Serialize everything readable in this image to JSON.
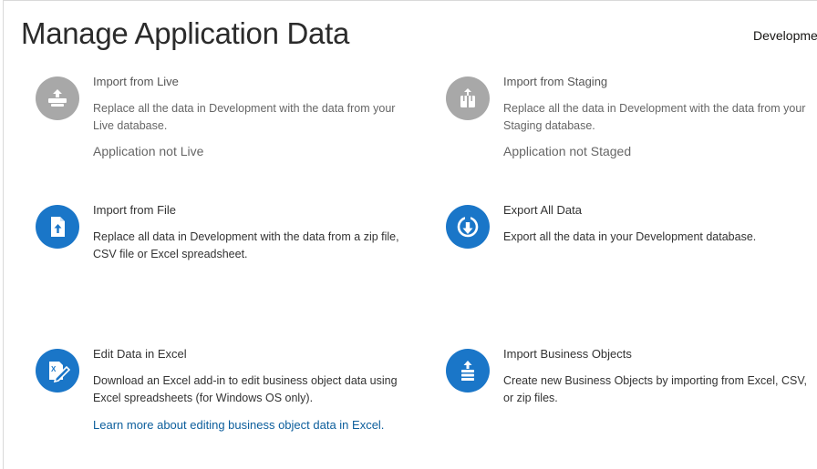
{
  "page": {
    "title": "Manage Application Data",
    "environment": "Development"
  },
  "cards": [
    {
      "title": "Import from Live",
      "description": "Replace all the data in Development with the data from your Live database.",
      "status": "Application not Live",
      "icon": "import-tray-icon",
      "enabled": false
    },
    {
      "title": "Import from Staging",
      "description": "Replace all the data in Development with the data from your Staging database.",
      "status": "Application not Staged",
      "icon": "import-box-icon",
      "enabled": false
    },
    {
      "title": "Import from File",
      "description": "Replace all data in Development with the data from a zip file, CSV file or Excel spreadsheet.",
      "icon": "file-upload-icon",
      "enabled": true
    },
    {
      "title": "Export All Data",
      "description": "Export all the data in your Development database.",
      "icon": "download-circle-icon",
      "enabled": true
    },
    {
      "title": "Edit Data in Excel",
      "description": "Download an Excel add-in to edit business object data using Excel spreadsheets (for Windows OS only).",
      "link": "Learn more about editing business object data in Excel.",
      "icon": "excel-edit-icon",
      "enabled": true
    },
    {
      "title": "Import Business Objects",
      "description": "Create new Business Objects by importing from Excel, CSV, or zip files.",
      "icon": "import-stack-icon",
      "enabled": true
    }
  ],
  "colors": {
    "accent": "#1a76c8",
    "disabled_icon": "#a8a8a8",
    "link": "#0c5e9c"
  }
}
